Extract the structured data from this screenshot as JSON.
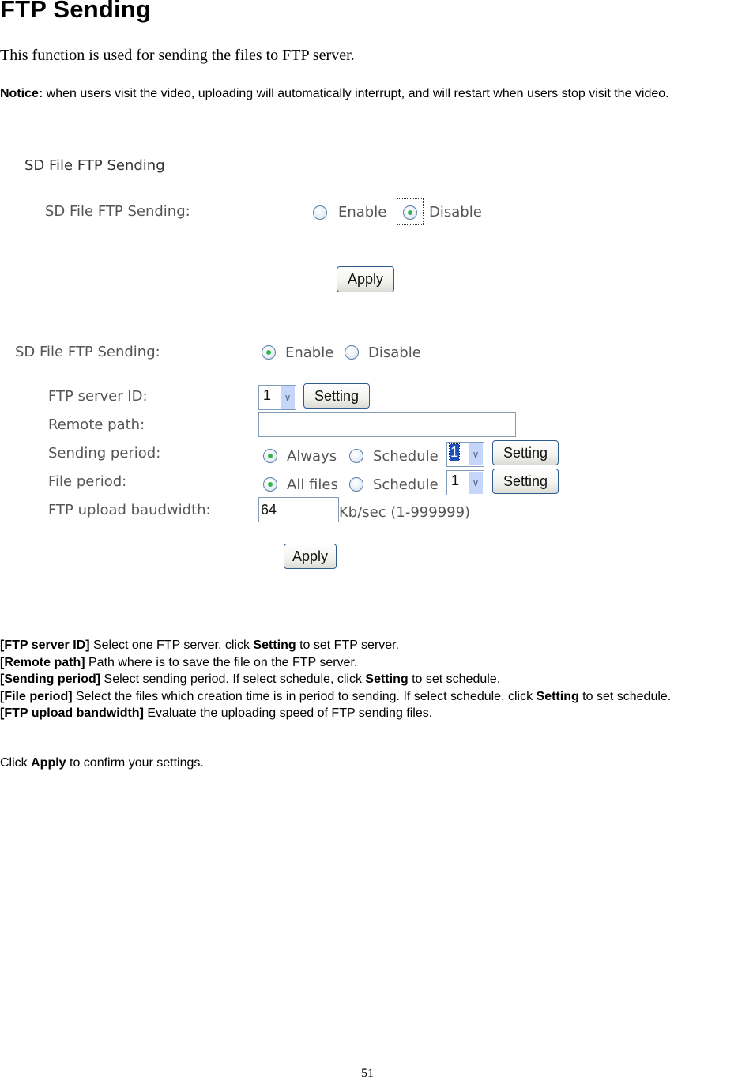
{
  "heading": "FTP Sending",
  "intro": "This function is used for sending the files to FTP server.",
  "notice": {
    "label": "Notice:",
    "text": " when users visit the video, uploading will automatically interrupt, and will restart when users stop visit the video."
  },
  "panel1": {
    "title": "SD File FTP Sending",
    "field_label": "SD File FTP Sending:",
    "options": [
      "Enable",
      "Disable"
    ],
    "selected": "Disable",
    "apply_label": "Apply"
  },
  "panel2": {
    "field_label": "SD File FTP Sending:",
    "options": [
      "Enable",
      "Disable"
    ],
    "selected": "Enable",
    "ftp_server_id": {
      "label": "FTP server ID:",
      "value": "1",
      "setting_label": "Setting"
    },
    "remote_path": {
      "label": "Remote path:",
      "value": ""
    },
    "sending_period": {
      "label": "Sending period:",
      "options": [
        "Always",
        "Schedule"
      ],
      "selected": "Always",
      "schedule_value": "1",
      "setting_label": "Setting"
    },
    "file_period": {
      "label": "File period:",
      "options": [
        "All files",
        "Schedule"
      ],
      "selected": "All files",
      "schedule_value": "1",
      "setting_label": "Setting"
    },
    "bandwidth": {
      "label": "FTP upload baudwidth:",
      "value": "64",
      "unit": "Kb/sec (1-999999)"
    },
    "apply_label": "Apply"
  },
  "descriptions": [
    {
      "term": "[FTP server ID]",
      "parts": [
        " Select one FTP server, click ",
        "Setting",
        " to set FTP server."
      ]
    },
    {
      "term": "[Remote path]",
      "parts": [
        " Path where is to save the file on the FTP server."
      ]
    },
    {
      "term": "[Sending period]",
      "parts": [
        " Select sending period. If select schedule, click ",
        "Setting",
        " to set schedule."
      ]
    },
    {
      "term": "[File period]",
      "parts": [
        " Select the files which creation time is in period to sending. If select schedule, click ",
        "Setting",
        " to set schedule."
      ]
    },
    {
      "term": "[FTP upload bandwidth]",
      "parts": [
        " Evaluate the uploading speed of FTP sending files."
      ]
    }
  ],
  "footer_note": {
    "pre": "Click ",
    "bold": "Apply",
    "post": " to confirm your settings."
  },
  "page_number": "51"
}
